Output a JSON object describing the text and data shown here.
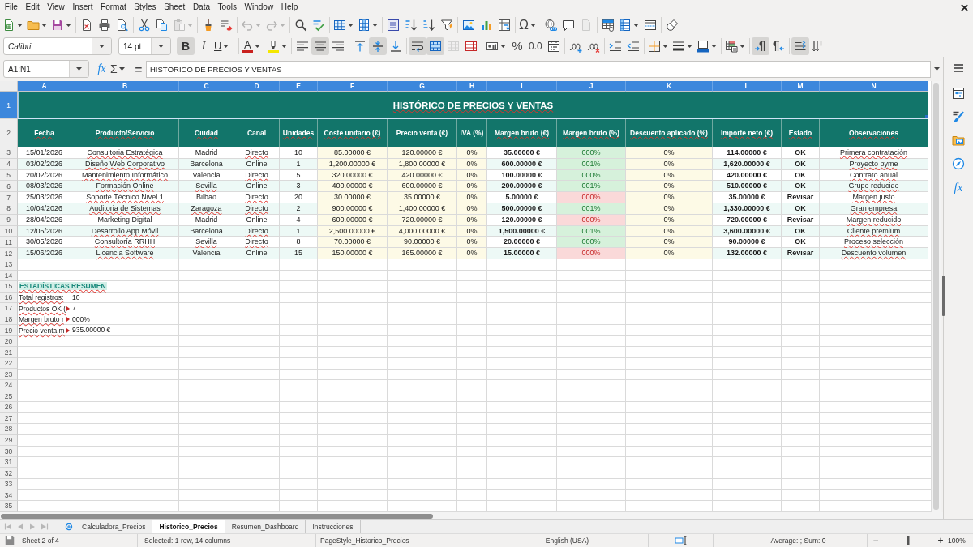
{
  "menu_bar": [
    "File",
    "Edit",
    "View",
    "Insert",
    "Format",
    "Styles",
    "Sheet",
    "Data",
    "Tools",
    "Window",
    "Help"
  ],
  "standard_toolbar": {
    "paste": {
      "disabled": true
    },
    "undo": {
      "disabled": true
    },
    "redo": {
      "disabled": true
    },
    "special_character": "Ω",
    "header_footer": {
      "disabled": true
    }
  },
  "format_toolbar": {
    "font_name": "Calibri",
    "font_size": "14 pt",
    "bold": {
      "glyph": "B",
      "pressed": true
    },
    "italic": {
      "glyph": "I",
      "pressed": false
    },
    "underline": {
      "glyph": "U",
      "pressed": false
    },
    "font_color": "A",
    "align_left": {
      "pressed": false
    },
    "align_center": {
      "pressed": true
    },
    "align_right": {
      "pressed": false
    },
    "align_top": {
      "pressed": false
    },
    "align_middle": {
      "pressed": true
    },
    "align_bottom": {
      "pressed": false
    },
    "wrap_text": {
      "pressed": true
    },
    "merge_and_center": {
      "pressed": true
    },
    "merge_cells": {
      "disabled": true
    },
    "percent": "%",
    "number": "0.0",
    "left_to_right": {
      "pressed": true
    },
    "right_to_left": {
      "pressed": false
    },
    "text_horizontal": {
      "pressed": true
    },
    "text_vertical": {
      "pressed": false
    }
  },
  "formula_bar": {
    "name_box": "A1:N1",
    "function_wizard": "fx",
    "sum": "Σ",
    "equals": "=",
    "content": "HISTÓRICO DE PRECIOS Y VENTAS"
  },
  "sidebar": {
    "functions": "fx"
  },
  "sheet": {
    "column_headers": [
      {
        "label": "A",
        "selected": true
      },
      {
        "label": "B",
        "selected": true
      },
      {
        "label": "C",
        "selected": true
      },
      {
        "label": "D",
        "selected": true
      },
      {
        "label": "E",
        "selected": true
      },
      {
        "label": "F",
        "selected": true
      },
      {
        "label": "G",
        "selected": true
      },
      {
        "label": "H",
        "selected": true
      },
      {
        "label": "I",
        "selected": true
      },
      {
        "label": "J",
        "selected": true
      },
      {
        "label": "K",
        "selected": true
      },
      {
        "label": "L",
        "selected": true
      },
      {
        "label": "M",
        "selected": true
      },
      {
        "label": "N",
        "selected": true
      }
    ],
    "row_headers": [
      {
        "label": "1",
        "selected": true
      },
      {
        "label": "2",
        "selected": false
      },
      {
        "label": "3",
        "selected": false
      },
      {
        "label": "4",
        "selected": false
      },
      {
        "label": "5",
        "selected": false
      },
      {
        "label": "6",
        "selected": false
      },
      {
        "label": "7",
        "selected": false
      },
      {
        "label": "8",
        "selected": false
      },
      {
        "label": "9",
        "selected": false
      },
      {
        "label": "10",
        "selected": false
      },
      {
        "label": "11",
        "selected": false
      },
      {
        "label": "12",
        "selected": false
      },
      {
        "label": "13",
        "selected": false
      },
      {
        "label": "14",
        "selected": false
      },
      {
        "label": "15",
        "selected": false
      },
      {
        "label": "16",
        "selected": false
      },
      {
        "label": "17",
        "selected": false
      },
      {
        "label": "18",
        "selected": false
      },
      {
        "label": "19",
        "selected": false
      },
      {
        "label": "20",
        "selected": false
      },
      {
        "label": "21",
        "selected": false
      },
      {
        "label": "22",
        "selected": false
      },
      {
        "label": "23",
        "selected": false
      },
      {
        "label": "24",
        "selected": false
      },
      {
        "label": "25",
        "selected": false
      },
      {
        "label": "26",
        "selected": false
      },
      {
        "label": "27",
        "selected": false
      },
      {
        "label": "28",
        "selected": false
      },
      {
        "label": "29",
        "selected": false
      },
      {
        "label": "30",
        "selected": false
      },
      {
        "label": "31",
        "selected": false
      },
      {
        "label": "32",
        "selected": false
      },
      {
        "label": "33",
        "selected": false
      },
      {
        "label": "34",
        "selected": false
      },
      {
        "label": "35",
        "selected": false
      }
    ],
    "title": {
      "text": "HISTÓRICO DE PRECIOS Y VENTAS",
      "misspelled": true,
      "selected": true
    },
    "header": [
      {
        "text": "Fecha",
        "misspelled": true
      },
      {
        "text": "Producto/Servicio",
        "misspelled": true
      },
      {
        "text": "Ciudad",
        "misspelled": true
      },
      {
        "text": "Canal",
        "misspelled": false
      },
      {
        "text": "Unidades",
        "misspelled": true
      },
      {
        "text": "Coste unitario (€)",
        "misspelled": true
      },
      {
        "text": "Precio venta (€)",
        "misspelled": false
      },
      {
        "text": "IVA (%)",
        "misspelled": false
      },
      {
        "text": "Margen bruto (€)",
        "misspelled": true
      },
      {
        "text": "Margen bruto (%)",
        "misspelled": true
      },
      {
        "text": "Descuento aplicado (%)",
        "misspelled": true
      },
      {
        "text": "Importe neto (€)",
        "misspelled": true
      },
      {
        "text": "Estado",
        "misspelled": true
      },
      {
        "text": "Observaciones",
        "misspelled": true
      }
    ],
    "rows": [
      {
        "low_margin": false,
        "cells": [
          {
            "text": "15/01/2026",
            "misspelled": false
          },
          {
            "text": "Consultoria Estratégica",
            "misspelled": true
          },
          {
            "text": "Madrid",
            "misspelled": false
          },
          {
            "text": "Directo",
            "misspelled": true
          },
          {
            "text": "10",
            "misspelled": false
          },
          {
            "text": "85.00000 €",
            "misspelled": false
          },
          {
            "text": "120.00000 €",
            "misspelled": false
          },
          {
            "text": "0%",
            "misspelled": false
          },
          {
            "text": "35.00000 €",
            "misspelled": false
          },
          {
            "text": "000%",
            "misspelled": false
          },
          {
            "text": "0%",
            "misspelled": false
          },
          {
            "text": "114.00000 €",
            "misspelled": false
          },
          {
            "text": "OK",
            "misspelled": false
          },
          {
            "text": "Primera contratación",
            "misspelled": true
          }
        ]
      },
      {
        "low_margin": false,
        "cells": [
          {
            "text": "03/02/2026",
            "misspelled": false
          },
          {
            "text": "Diseño Web Corporativo",
            "misspelled": true
          },
          {
            "text": "Barcelona",
            "misspelled": false
          },
          {
            "text": "Online",
            "misspelled": false
          },
          {
            "text": "1",
            "misspelled": false
          },
          {
            "text": "1,200.00000 €",
            "misspelled": false
          },
          {
            "text": "1,800.00000 €",
            "misspelled": false
          },
          {
            "text": "0%",
            "misspelled": false
          },
          {
            "text": "600.00000 €",
            "misspelled": false
          },
          {
            "text": "001%",
            "misspelled": false
          },
          {
            "text": "0%",
            "misspelled": false
          },
          {
            "text": "1,620.00000 €",
            "misspelled": false
          },
          {
            "text": "OK",
            "misspelled": false
          },
          {
            "text": "Proyecto pyme",
            "misspelled": true
          }
        ]
      },
      {
        "low_margin": false,
        "cells": [
          {
            "text": "20/02/2026",
            "misspelled": false
          },
          {
            "text": "Mantenimiento Informático",
            "misspelled": true
          },
          {
            "text": "Valencia",
            "misspelled": false
          },
          {
            "text": "Directo",
            "misspelled": true
          },
          {
            "text": "5",
            "misspelled": false
          },
          {
            "text": "320.00000 €",
            "misspelled": false
          },
          {
            "text": "420.00000 €",
            "misspelled": false
          },
          {
            "text": "0%",
            "misspelled": false
          },
          {
            "text": "100.00000 €",
            "misspelled": false
          },
          {
            "text": "000%",
            "misspelled": false
          },
          {
            "text": "0%",
            "misspelled": false
          },
          {
            "text": "420.00000 €",
            "misspelled": false
          },
          {
            "text": "OK",
            "misspelled": false
          },
          {
            "text": "Contrato anual",
            "misspelled": true
          }
        ]
      },
      {
        "low_margin": false,
        "cells": [
          {
            "text": "08/03/2026",
            "misspelled": false
          },
          {
            "text": "Formación Online",
            "misspelled": true
          },
          {
            "text": "Sevilla",
            "misspelled": true
          },
          {
            "text": "Online",
            "misspelled": false
          },
          {
            "text": "3",
            "misspelled": false
          },
          {
            "text": "400.00000 €",
            "misspelled": false
          },
          {
            "text": "600.00000 €",
            "misspelled": false
          },
          {
            "text": "0%",
            "misspelled": false
          },
          {
            "text": "200.00000 €",
            "misspelled": false
          },
          {
            "text": "001%",
            "misspelled": false
          },
          {
            "text": "0%",
            "misspelled": false
          },
          {
            "text": "510.00000 €",
            "misspelled": false
          },
          {
            "text": "OK",
            "misspelled": false
          },
          {
            "text": "Grupo reducido",
            "misspelled": true
          }
        ]
      },
      {
        "low_margin": true,
        "cells": [
          {
            "text": "25/03/2026",
            "misspelled": false
          },
          {
            "text": "Soporte Técnico Nivel 1",
            "misspelled": true
          },
          {
            "text": "Bilbao",
            "misspelled": false
          },
          {
            "text": "Directo",
            "misspelled": true
          },
          {
            "text": "20",
            "misspelled": false
          },
          {
            "text": "30.00000 €",
            "misspelled": false
          },
          {
            "text": "35.00000 €",
            "misspelled": false
          },
          {
            "text": "0%",
            "misspelled": false
          },
          {
            "text": "5.00000 €",
            "misspelled": false
          },
          {
            "text": "000%",
            "misspelled": false
          },
          {
            "text": "0%",
            "misspelled": false
          },
          {
            "text": "35.00000 €",
            "misspelled": false
          },
          {
            "text": "Revisar",
            "misspelled": false
          },
          {
            "text": "Margen justo",
            "misspelled": true
          }
        ]
      },
      {
        "low_margin": false,
        "cells": [
          {
            "text": "10/04/2026",
            "misspelled": false
          },
          {
            "text": "Auditoria de Sistemas",
            "misspelled": true
          },
          {
            "text": "Zaragoza",
            "misspelled": true
          },
          {
            "text": "Directo",
            "misspelled": true
          },
          {
            "text": "2",
            "misspelled": false
          },
          {
            "text": "900.00000 €",
            "misspelled": false
          },
          {
            "text": "1,400.00000 €",
            "misspelled": false
          },
          {
            "text": "0%",
            "misspelled": false
          },
          {
            "text": "500.00000 €",
            "misspelled": false
          },
          {
            "text": "001%",
            "misspelled": false
          },
          {
            "text": "0%",
            "misspelled": false
          },
          {
            "text": "1,330.00000 €",
            "misspelled": false
          },
          {
            "text": "OK",
            "misspelled": false
          },
          {
            "text": "Gran empresa",
            "misspelled": true
          }
        ]
      },
      {
        "low_margin": true,
        "cells": [
          {
            "text": "28/04/2026",
            "misspelled": false
          },
          {
            "text": "Marketing Digital",
            "misspelled": false
          },
          {
            "text": "Madrid",
            "misspelled": false
          },
          {
            "text": "Online",
            "misspelled": false
          },
          {
            "text": "4",
            "misspelled": false
          },
          {
            "text": "600.00000 €",
            "misspelled": false
          },
          {
            "text": "720.00000 €",
            "misspelled": false
          },
          {
            "text": "0%",
            "misspelled": false
          },
          {
            "text": "120.00000 €",
            "misspelled": false
          },
          {
            "text": "000%",
            "misspelled": false
          },
          {
            "text": "0%",
            "misspelled": false
          },
          {
            "text": "720.00000 €",
            "misspelled": false
          },
          {
            "text": "Revisar",
            "misspelled": false
          },
          {
            "text": "Margen reducido",
            "misspelled": true
          }
        ]
      },
      {
        "low_margin": false,
        "cells": [
          {
            "text": "12/05/2026",
            "misspelled": false
          },
          {
            "text": "Desarrollo App Móvil",
            "misspelled": true
          },
          {
            "text": "Barcelona",
            "misspelled": false
          },
          {
            "text": "Directo",
            "misspelled": true
          },
          {
            "text": "1",
            "misspelled": false
          },
          {
            "text": "2,500.00000 €",
            "misspelled": false
          },
          {
            "text": "4,000.00000 €",
            "misspelled": false
          },
          {
            "text": "0%",
            "misspelled": false
          },
          {
            "text": "1,500.00000 €",
            "misspelled": false
          },
          {
            "text": "001%",
            "misspelled": false
          },
          {
            "text": "0%",
            "misspelled": false
          },
          {
            "text": "3,600.00000 €",
            "misspelled": false
          },
          {
            "text": "OK",
            "misspelled": false
          },
          {
            "text": "Cliente premium",
            "misspelled": true
          }
        ]
      },
      {
        "low_margin": false,
        "cells": [
          {
            "text": "30/05/2026",
            "misspelled": false
          },
          {
            "text": "Consultoría RRHH",
            "misspelled": true
          },
          {
            "text": "Sevilla",
            "misspelled": true
          },
          {
            "text": "Directo",
            "misspelled": true
          },
          {
            "text": "8",
            "misspelled": false
          },
          {
            "text": "70.00000 €",
            "misspelled": false
          },
          {
            "text": "90.00000 €",
            "misspelled": false
          },
          {
            "text": "0%",
            "misspelled": false
          },
          {
            "text": "20.00000 €",
            "misspelled": false
          },
          {
            "text": "000%",
            "misspelled": false
          },
          {
            "text": "0%",
            "misspelled": false
          },
          {
            "text": "90.00000 €",
            "misspelled": false
          },
          {
            "text": "OK",
            "misspelled": false
          },
          {
            "text": "Proceso selección",
            "misspelled": true
          }
        ]
      },
      {
        "low_margin": true,
        "cells": [
          {
            "text": "15/06/2026",
            "misspelled": false
          },
          {
            "text": "Licencia Software",
            "misspelled": true
          },
          {
            "text": "Valencia",
            "misspelled": false
          },
          {
            "text": "Online",
            "misspelled": false
          },
          {
            "text": "15",
            "misspelled": false
          },
          {
            "text": "150.00000 €",
            "misspelled": false
          },
          {
            "text": "165.00000 €",
            "misspelled": false
          },
          {
            "text": "0%",
            "misspelled": false
          },
          {
            "text": "15.00000 €",
            "misspelled": false
          },
          {
            "text": "000%",
            "misspelled": false
          },
          {
            "text": "0%",
            "misspelled": false
          },
          {
            "text": "132.00000 €",
            "misspelled": false
          },
          {
            "text": "Revisar",
            "misspelled": false
          },
          {
            "text": "Descuento volumen",
            "misspelled": true
          }
        ]
      }
    ],
    "summary": {
      "title": {
        "text": "ESTADÍSTICAS RESUMEN",
        "misspelled": true
      },
      "items": [
        {
          "label": "Total registros:",
          "value": "10",
          "misspelled": true,
          "clipped": false
        },
        {
          "label": "Productos OK (",
          "value": "7",
          "misspelled": true,
          "clipped": true
        },
        {
          "label": "Margen bruto r",
          "value": "000%",
          "misspelled": true,
          "clipped": true
        },
        {
          "label": "Precio venta m",
          "value": "935.00000 €",
          "misspelled": true,
          "clipped": true
        }
      ]
    }
  },
  "sheet_tab_bar": {
    "navigation": {
      "disabled": true
    },
    "tabs": [
      {
        "label": "Calculadora_Precios",
        "selected": false
      },
      {
        "label": "Historico_Precios",
        "selected": true
      },
      {
        "label": "Resumen_Dashboard",
        "selected": false
      },
      {
        "label": "Instrucciones",
        "selected": false
      }
    ]
  },
  "status_bar": {
    "sheet": "Sheet 2 of 4",
    "selection": "Selected: 1 row, 14 columns",
    "page_style": "PageStyle_Historico_Precios",
    "language": "English (USA)",
    "summary": "Average: ; Sum: 0",
    "zoom_out": "−",
    "zoom_in": "+",
    "zoom": {
      "level": 0.5
    },
    "zoom_percent": "100%"
  }
}
